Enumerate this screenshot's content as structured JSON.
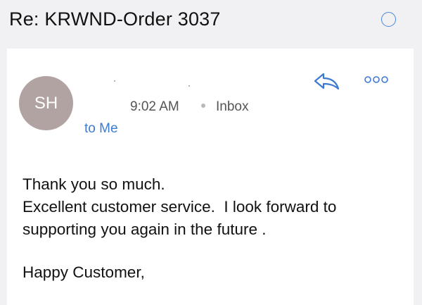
{
  "header": {
    "subject": "Re: KRWND-Order 3037",
    "unread_indicator_icon": "circle-icon",
    "accent_color": "#3d7bd3"
  },
  "message": {
    "avatar_initials": "SH",
    "avatar_color": "#b2a3a3",
    "time": "9:02 AM",
    "folder": "Inbox",
    "recipient": "to Me",
    "actions": {
      "reply_icon": "reply-arrow-icon",
      "more_icon": "more-options-icon"
    },
    "body_lines": [
      "Thank you so much.",
      "Excellent customer service.  I look forward to",
      "supporting you again in the future ."
    ],
    "signoff": "Happy Customer,"
  }
}
